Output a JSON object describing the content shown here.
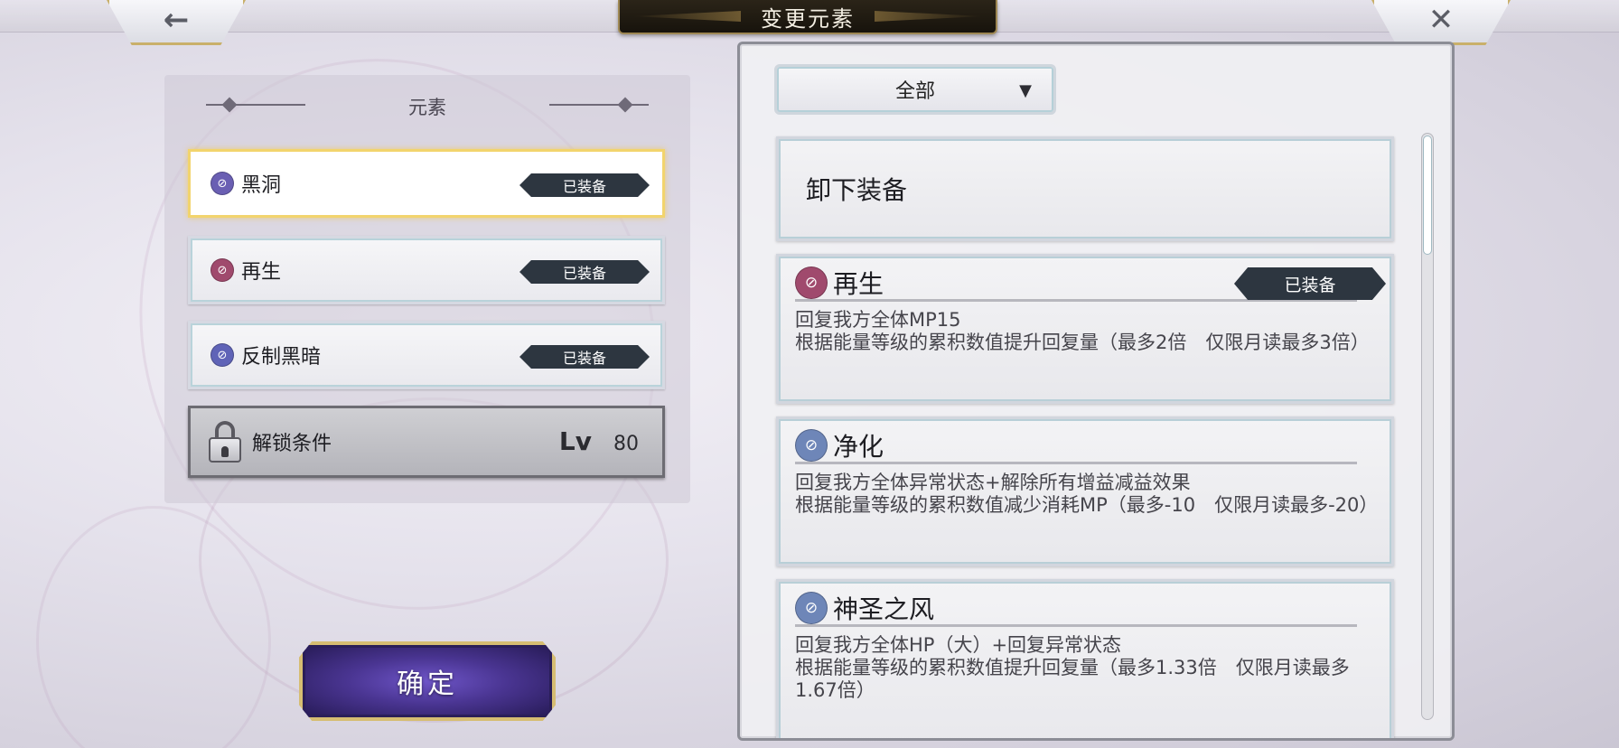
{
  "header": {
    "title": "变更元素",
    "back_icon": "←",
    "close_icon": "✕"
  },
  "element_panel": {
    "section_title": "元素",
    "items": [
      {
        "name": "黑洞",
        "badge": "已装备",
        "icon_color": "#6a5fb3",
        "selected": true
      },
      {
        "name": "再生",
        "badge": "已装备",
        "icon_color": "#a04a6d",
        "selected": false
      },
      {
        "name": "反制黑暗",
        "badge": "已装备",
        "icon_color": "#5f63b7",
        "selected": false
      }
    ],
    "locked": {
      "label": "解锁条件",
      "lv_label": "Lv",
      "lv_value": "80"
    }
  },
  "confirm_button": {
    "label": "确定"
  },
  "skill_panel": {
    "filter": {
      "value": "全部",
      "arrow": "▼"
    },
    "unequip_label": "卸下装备",
    "skills": [
      {
        "name": "再生",
        "badge": "已装备",
        "icon_color": "#a04a6d",
        "desc1": "回复我方全体MP15",
        "desc2": "根据能量等级的累积数值提升回复量（最多2倍　仅限月读最多3倍）"
      },
      {
        "name": "净化",
        "icon_color": "#6e86b8",
        "desc1": "回复我方全体异常状态+解除所有增益减益效果",
        "desc2": "根据能量等级的累积数值减少消耗MP（最多-10　仅限月读最多-20）"
      },
      {
        "name": "神圣之风",
        "icon_color": "#6e86b8",
        "desc1": "回复我方全体HP（大）+回复异常状态",
        "desc2": "根据能量等级的累积数值提升回复量（最多1.33倍　仅限月读最多1.67倍）"
      }
    ]
  },
  "colors": {
    "selected_border": "#f2d46d",
    "badge_bg": "#2d3640",
    "confirm_bg": "#4a3592",
    "gold_trim": "#c9b06a"
  }
}
